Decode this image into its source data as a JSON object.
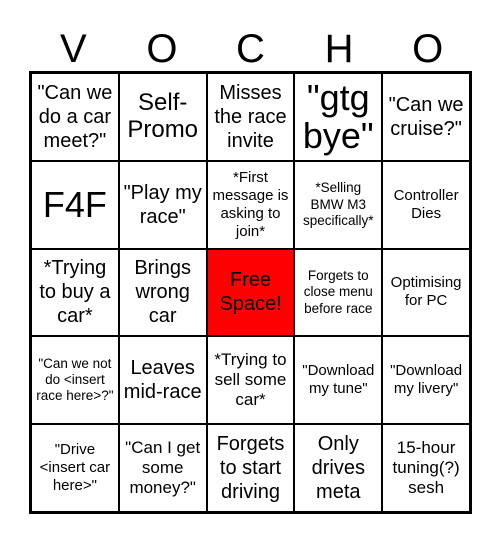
{
  "header": {
    "letters": [
      "V",
      "O",
      "C",
      "H",
      "O"
    ]
  },
  "free_space_color": "#ff0000",
  "cells": [
    [
      "\"Can we do a car meet?\"",
      "Self-Promo",
      "Misses the race invite",
      "\"gtg bye\"",
      "\"Can we cruise?\""
    ],
    [
      "F4F",
      "\"Play my race\"",
      "*First message is asking to join*",
      "*Selling BMW M3 specifically*",
      "Controller Dies"
    ],
    [
      "*Trying to buy a car*",
      "Brings wrong car",
      "Free Space!",
      "Forgets to close menu before race",
      "Optimising for PC"
    ],
    [
      "\"Can we not do <insert race here>?\"",
      "Leaves mid-race",
      "*Trying to sell some car*",
      "\"Download my tune\"",
      "\"Download my livery\""
    ],
    [
      "\"Drive <insert car here>\"",
      "\"Can I get some money?\"",
      "Forgets to start driving",
      "Only drives meta",
      "15-hour tuning(?) sesh"
    ]
  ]
}
